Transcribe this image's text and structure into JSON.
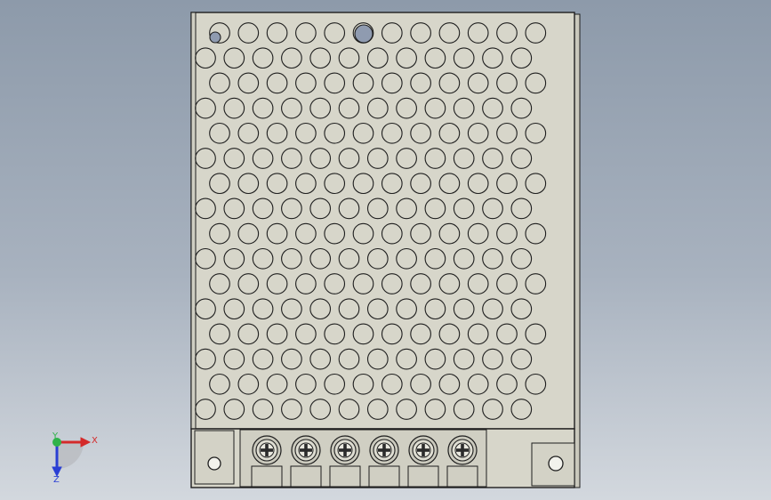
{
  "viewport": {
    "background_top": "#8d9aaa",
    "background_bottom": "#d3d8de"
  },
  "model": {
    "name": "power-supply-unit",
    "body_color": "#d7d6ca",
    "edge_color": "#1e1e1e",
    "perforation_rows": 16,
    "perforation_columns_even_row": 12,
    "perforation_columns_odd_row": 12,
    "terminal_screw_count": 6,
    "screw_slot_shape": "cross"
  },
  "triad": {
    "x_label": "X",
    "y_label": "Y",
    "z_label": "Z",
    "x_color": "#d42a2a",
    "y_color": "#2fb24a",
    "z_color": "#2a3fd4"
  }
}
